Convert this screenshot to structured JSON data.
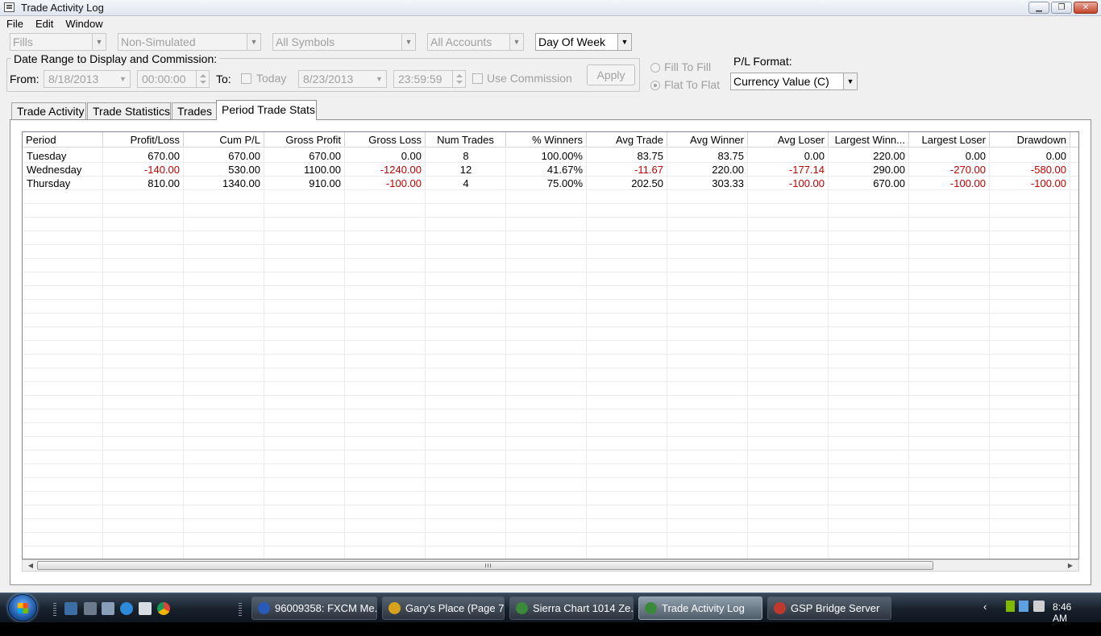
{
  "window": {
    "title": "Trade Activity Log"
  },
  "menu": [
    "File",
    "Edit",
    "Window"
  ],
  "filters": {
    "fills": "Fills",
    "simulated": "Non-Simulated",
    "symbols": "All Symbols",
    "accounts": "All Accounts",
    "period": "Day Of Week"
  },
  "date_range": {
    "label": "Date Range to Display and Commission:",
    "from_label": "From:",
    "from_date": "8/18/2013",
    "from_time": "00:00:00",
    "to_label": "To:",
    "today_label": "Today",
    "to_date": "8/23/2013",
    "to_time": "23:59:59",
    "use_commission_label": "Use Commission",
    "apply_label": "Apply"
  },
  "fill_mode": {
    "fill_to_fill": "Fill To Fill",
    "flat_to_flat": "Flat To Flat",
    "selected": "flat_to_flat"
  },
  "pl_format": {
    "label": "P/L Format:",
    "value": "Currency Value (C)"
  },
  "tabs": [
    {
      "label": "Trade Activity"
    },
    {
      "label": "Trade Statistics"
    },
    {
      "label": "Trades"
    },
    {
      "label": "Period Trade Stats"
    }
  ],
  "table": {
    "columns": [
      "Period",
      "Profit/Loss",
      "Cum P/L",
      "Gross Profit",
      "Gross Loss",
      "Num Trades",
      "% Winners",
      "Avg Trade",
      "Avg Winner",
      "Avg Loser",
      "Largest Winn...",
      "Largest Loser",
      "Drawdown"
    ],
    "rows": [
      [
        "Tuesday",
        "670.00",
        "670.00",
        "670.00",
        "0.00",
        "8",
        "100.00%",
        "83.75",
        "83.75",
        "0.00",
        "220.00",
        "0.00",
        "0.00"
      ],
      [
        "Wednesday",
        "-140.00",
        "530.00",
        "1100.00",
        "-1240.00",
        "12",
        "41.67%",
        "-11.67",
        "220.00",
        "-177.14",
        "290.00",
        "-270.00",
        "-580.00"
      ],
      [
        "Thursday",
        "810.00",
        "1340.00",
        "910.00",
        "-100.00",
        "4",
        "75.00%",
        "202.50",
        "303.33",
        "-100.00",
        "670.00",
        "-100.00",
        "-100.00"
      ]
    ]
  },
  "taskbar": {
    "items": [
      {
        "label": "96009358: FXCM Me...",
        "icon_color": "#2a5ab8"
      },
      {
        "label": "Gary's Place (Page 7...",
        "icon_color": "#d9a21b"
      },
      {
        "label": "Sierra Chart 1014 Ze...",
        "icon_color": "#3a8a3a"
      },
      {
        "label": "Trade Activity Log",
        "icon_color": "#3a8a3a"
      },
      {
        "label": "GSP Bridge Server",
        "icon_color": "#c0392b"
      }
    ],
    "clock": "8:46 AM"
  },
  "colors": {
    "negative": "#c00000",
    "active_tab_bg": "#ffffff"
  }
}
